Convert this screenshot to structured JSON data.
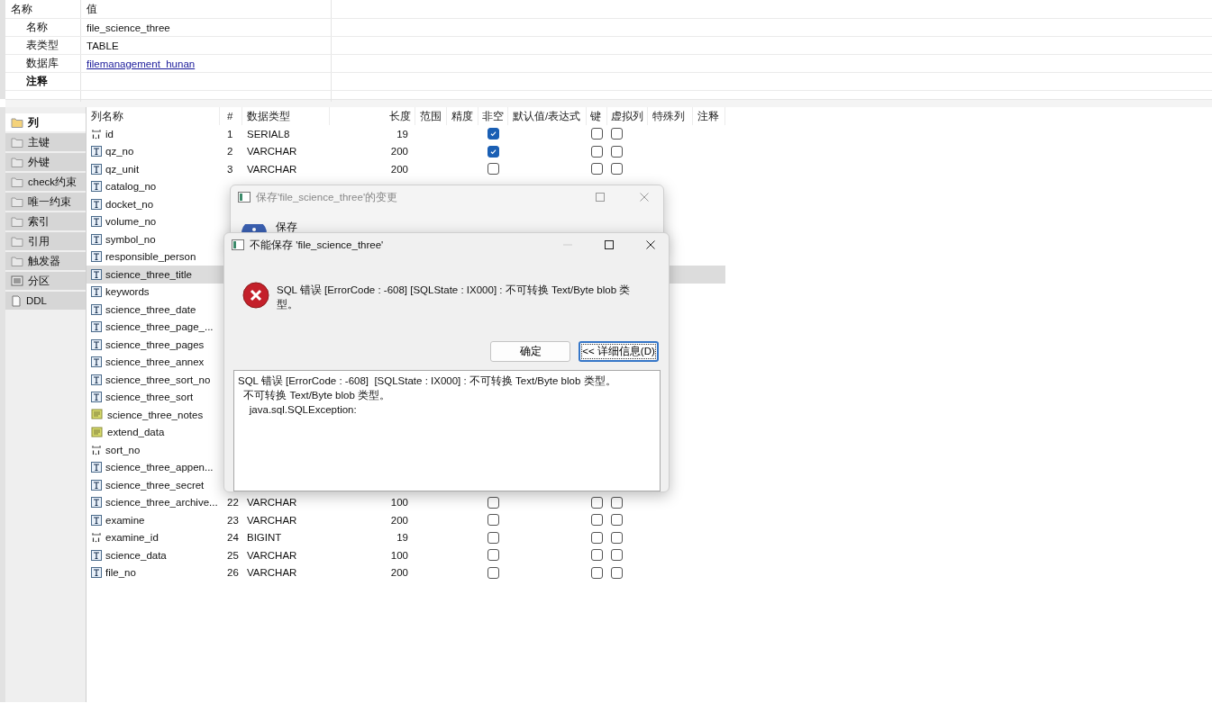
{
  "properties": {
    "columns": [
      "名称",
      "值"
    ],
    "rows": [
      {
        "name": "名称",
        "value": "file_science_three"
      },
      {
        "name": "表类型",
        "value": "TABLE"
      },
      {
        "name": "数据库",
        "value": "filemanagement_hunan",
        "kind": "link"
      },
      {
        "name": "注释",
        "kind": "bold"
      }
    ]
  },
  "sidebar": {
    "items": [
      {
        "label": "列",
        "kind": "folder",
        "selected": true
      },
      {
        "label": "主键",
        "kind": "folder",
        "selected": false
      },
      {
        "label": "外键",
        "kind": "folder",
        "selected": false
      },
      {
        "label": "check约束",
        "kind": "folder",
        "selected": false
      },
      {
        "label": "唯一约束",
        "kind": "folder",
        "selected": false
      },
      {
        "label": "索引",
        "kind": "folder",
        "selected": false
      },
      {
        "label": "引用",
        "kind": "folder",
        "selected": false
      },
      {
        "label": "触发器",
        "kind": "folder",
        "selected": false
      },
      {
        "label": "分区",
        "kind": "partition",
        "selected": false
      },
      {
        "label": "DDL",
        "kind": "document",
        "selected": false
      }
    ]
  },
  "table": {
    "columns": [
      "列名称",
      "#",
      "数据类型",
      "长度",
      "范围",
      "精度",
      "非空",
      "默认值/表达式",
      "键",
      "虚拟列",
      "特殊列",
      "注释"
    ],
    "rows": [
      {
        "name": "id",
        "kind": "number",
        "num": "1",
        "type": "SERIAL8",
        "length": "19",
        "not_null": true,
        "key": false,
        "virtual": false,
        "selected": false
      },
      {
        "name": "qz_no",
        "kind": "text",
        "num": "2",
        "type": "VARCHAR",
        "length": "200",
        "not_null": true,
        "key": false,
        "virtual": false,
        "selected": false
      },
      {
        "name": "qz_unit",
        "kind": "text",
        "num": "3",
        "type": "VARCHAR",
        "length": "200",
        "not_null": false,
        "key": false,
        "virtual": false,
        "selected": false
      },
      {
        "name": "catalog_no",
        "kind": "text",
        "selected": false
      },
      {
        "name": "docket_no",
        "kind": "text",
        "selected": false
      },
      {
        "name": "volume_no",
        "kind": "text",
        "selected": false
      },
      {
        "name": "symbol_no",
        "kind": "text",
        "selected": false
      },
      {
        "name": "responsible_person",
        "kind": "text",
        "selected": false
      },
      {
        "name": "science_three_title",
        "kind": "text",
        "selected": true
      },
      {
        "name": "keywords",
        "kind": "text",
        "selected": false
      },
      {
        "name": "science_three_date",
        "kind": "text",
        "selected": false
      },
      {
        "name": "science_three_page_...",
        "kind": "text",
        "selected": false
      },
      {
        "name": "science_three_pages",
        "kind": "text",
        "selected": false
      },
      {
        "name": "science_three_annex",
        "kind": "text",
        "selected": false
      },
      {
        "name": "science_three_sort_no",
        "kind": "text",
        "selected": false
      },
      {
        "name": "science_three_sort",
        "kind": "text",
        "selected": false
      },
      {
        "name": "science_three_notes",
        "kind": "note",
        "selected": false
      },
      {
        "name": "extend_data",
        "kind": "note",
        "selected": false
      },
      {
        "name": "sort_no",
        "kind": "number",
        "selected": false
      },
      {
        "name": "science_three_appen...",
        "kind": "text",
        "selected": false
      },
      {
        "name": "science_three_secret",
        "kind": "text",
        "selected": false
      },
      {
        "name": "science_three_archive...",
        "kind": "text",
        "num": "22",
        "type": "VARCHAR",
        "length": "100",
        "not_null": false,
        "key": false,
        "virtual": false,
        "selected": false
      },
      {
        "name": "examine",
        "kind": "text",
        "num": "23",
        "type": "VARCHAR",
        "length": "200",
        "not_null": false,
        "key": false,
        "virtual": false,
        "selected": false
      },
      {
        "name": "examine_id",
        "kind": "number",
        "num": "24",
        "type": "BIGINT",
        "length": "19",
        "not_null": false,
        "key": false,
        "virtual": false,
        "selected": false
      },
      {
        "name": "science_data",
        "kind": "text",
        "num": "25",
        "type": "VARCHAR",
        "length": "100",
        "not_null": false,
        "key": false,
        "virtual": false,
        "selected": false
      },
      {
        "name": "file_no",
        "kind": "text",
        "num": "26",
        "type": "VARCHAR",
        "length": "200",
        "not_null": false,
        "key": false,
        "virtual": false,
        "selected": false
      }
    ]
  },
  "save_dialog": {
    "title": "保存'file_science_three'的变更",
    "label": "保存"
  },
  "error_dialog": {
    "title": "不能保存 'file_science_three'",
    "message": "SQL 错误 [ErrorCode : -608]  [SQLState : IX000] : 不可转换 Text/Byte blob 类型。",
    "buttons": [
      {
        "label": "确定",
        "focused": false
      },
      {
        "label": "<< 详细信息(D)",
        "focused": true
      }
    ],
    "details": [
      "SQL 错误 [ErrorCode : -608]  [SQLState : IX000] : 不可转换 Text/Byte blob 类型。",
      "  不可转换 Text/Byte blob 类型。",
      "    java.sql.SQLException:"
    ]
  }
}
